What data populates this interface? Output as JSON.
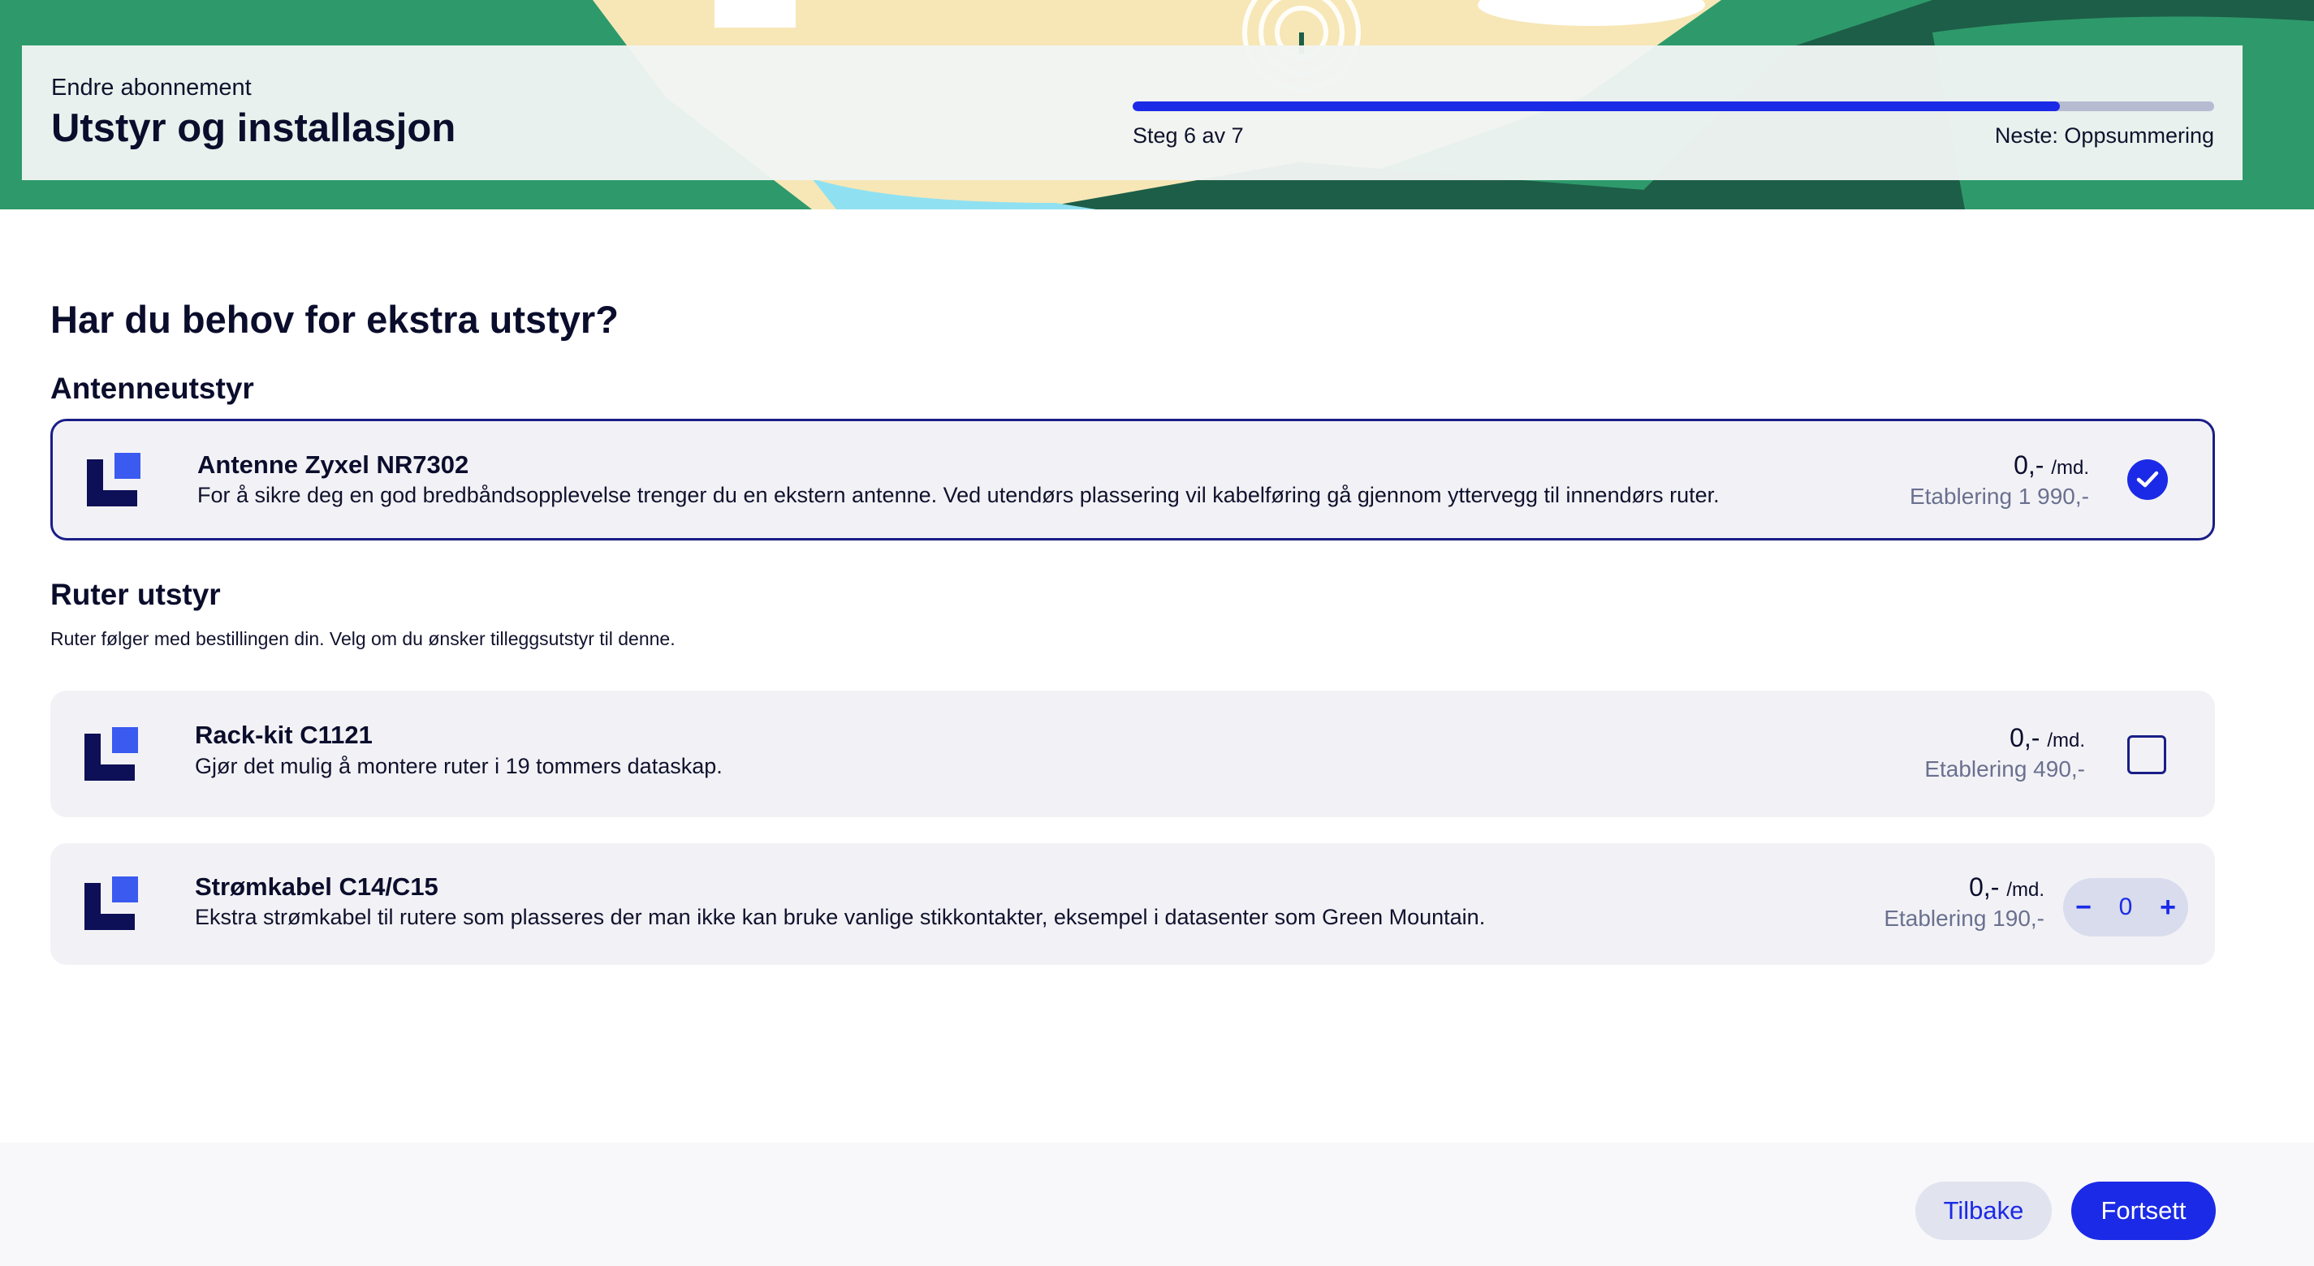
{
  "header": {
    "subtitle": "Endre abonnement",
    "title": "Utstyr og installasjon",
    "progress": {
      "current": 6,
      "total": 7,
      "fraction": 0.857
    },
    "step_text": "Steg 6 av 7",
    "next_text": "Neste: Oppsummering"
  },
  "main": {
    "question": "Har du behov for ekstra utstyr?",
    "sections": [
      {
        "title": "Antenneutstyr",
        "items": [
          {
            "name": "Antenne Zyxel NR7302",
            "description": "For å sikre deg en god bredbåndsopplevelse trenger du en ekstern antenne. Ved utendørs plassering vil kabelføring gå gjennom yttervegg til innendørs ruter.",
            "price": "0,-",
            "unit": "/md.",
            "setup": "Etablering 1 990,-",
            "control": "checkbox",
            "checked": true
          }
        ]
      },
      {
        "title": "Ruter utstyr",
        "description": "Ruter følger med bestillingen din. Velg om du ønsker tilleggsutstyr til denne.",
        "items": [
          {
            "name": "Rack-kit C1121",
            "description": "Gjør det mulig å montere ruter i 19 tommers dataskap.",
            "price": "0,-",
            "unit": "/md.",
            "setup": "Etablering 490,-",
            "control": "checkbox",
            "checked": false
          },
          {
            "name": "Strømkabel C14/C15",
            "description": "Ekstra strømkabel til rutere som plasseres der man ikke kan bruke vanlige stikkontakter, eksempel i datasenter som Green Mountain.",
            "price": "0,-",
            "unit": "/md.",
            "setup": "Etablering 190,-",
            "control": "stepper",
            "quantity": "0",
            "minus": "−",
            "plus": "+"
          }
        ]
      }
    ]
  },
  "footer": {
    "back_label": "Tilbake",
    "continue_label": "Fortsett"
  },
  "colors": {
    "accent": "#1b2ae6",
    "navy": "#0b0d2c",
    "card_bg": "#f2f2f6",
    "hero_green": "#2e9a6b",
    "hero_dark_green": "#1d5e48"
  },
  "icons": {
    "product": "product-logo-icon",
    "check": "checkmark-icon",
    "hero_signal": "signal-icon"
  }
}
